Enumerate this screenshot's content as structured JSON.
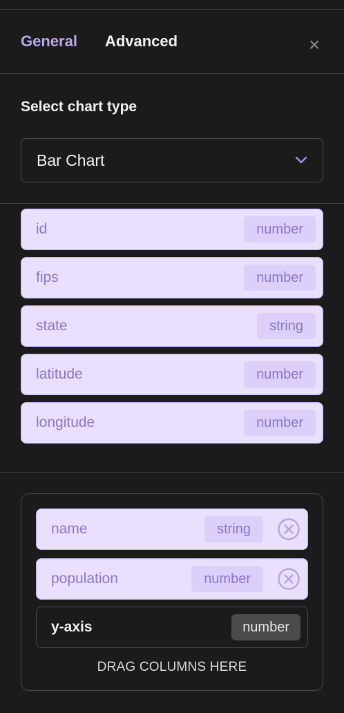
{
  "tabs": [
    {
      "label": "General"
    },
    {
      "label": "Advanced"
    }
  ],
  "close_label": "×",
  "chart_type": {
    "title": "Select chart type",
    "selected": "Bar Chart"
  },
  "columns": [
    {
      "name": "id",
      "type": "number"
    },
    {
      "name": "fips",
      "type": "number"
    },
    {
      "name": "state",
      "type": "string"
    },
    {
      "name": "latitude",
      "type": "number"
    },
    {
      "name": "longitude",
      "type": "number"
    }
  ],
  "dropzone": {
    "items": [
      {
        "name": "name",
        "type": "string"
      },
      {
        "name": "population",
        "type": "number"
      }
    ],
    "axis": {
      "label": "y-axis",
      "type": "number"
    },
    "hint": "DRAG COLUMNS HERE"
  },
  "colors": {
    "background": "#1b1b1b",
    "accent": "#b9a8e6",
    "chip_bg": "#e8e0fe",
    "chip_text": "#8978c7"
  }
}
